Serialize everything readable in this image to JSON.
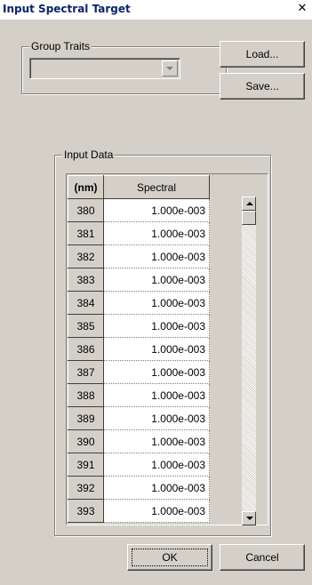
{
  "window": {
    "title": "Input Spectral Target",
    "close_glyph": "✕"
  },
  "group_traits": {
    "legend": "Group Traits",
    "selected": ""
  },
  "buttons": {
    "load": "Load...",
    "save": "Save...",
    "ok": "OK",
    "cancel": "Cancel"
  },
  "input_data": {
    "legend": "Input Data",
    "columns": [
      "(nm)",
      "Spectral"
    ],
    "rows": [
      {
        "nm": "380",
        "value": "1.000e-003"
      },
      {
        "nm": "381",
        "value": "1.000e-003"
      },
      {
        "nm": "382",
        "value": "1.000e-003"
      },
      {
        "nm": "383",
        "value": "1.000e-003"
      },
      {
        "nm": "384",
        "value": "1.000e-003"
      },
      {
        "nm": "385",
        "value": "1.000e-003"
      },
      {
        "nm": "386",
        "value": "1.000e-003"
      },
      {
        "nm": "387",
        "value": "1.000e-003"
      },
      {
        "nm": "388",
        "value": "1.000e-003"
      },
      {
        "nm": "389",
        "value": "1.000e-003"
      },
      {
        "nm": "390",
        "value": "1.000e-003"
      },
      {
        "nm": "391",
        "value": "1.000e-003"
      },
      {
        "nm": "392",
        "value": "1.000e-003"
      },
      {
        "nm": "393",
        "value": "1.000e-003"
      }
    ]
  },
  "icons": {
    "scroll_up": "arrow-up-icon",
    "scroll_down": "arrow-down-icon",
    "combo": "chevron-down-icon"
  }
}
